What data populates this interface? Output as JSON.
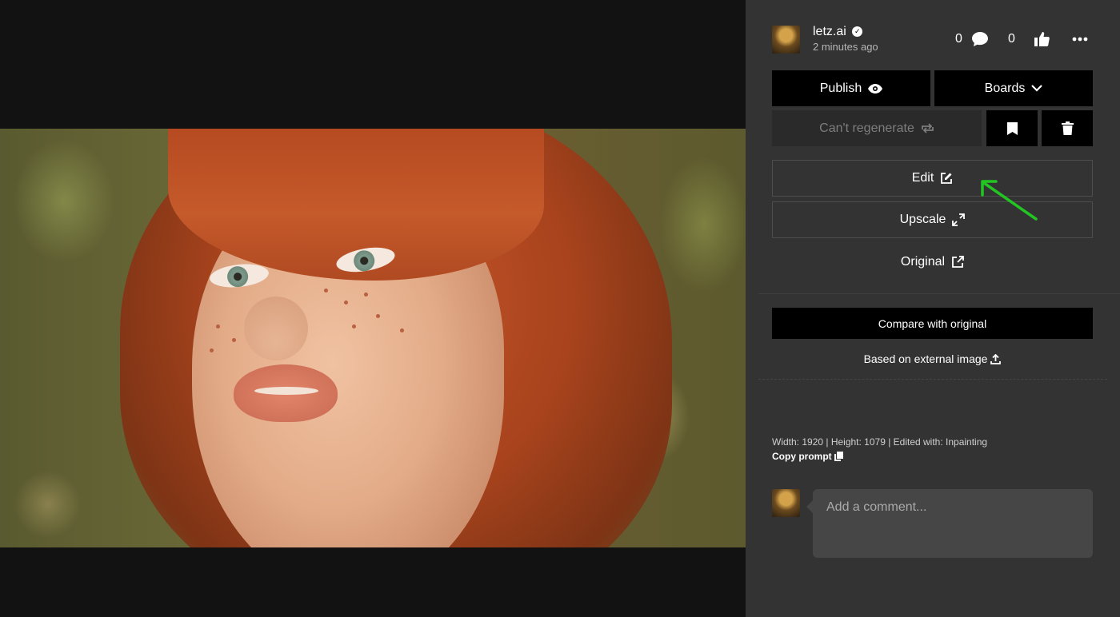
{
  "viewer": {
    "image_alt": "Portrait of a red-haired woman with freckles"
  },
  "header": {
    "username": "letz.ai",
    "timestamp": "2 minutes ago",
    "comment_count": "0",
    "like_count": "0"
  },
  "actions": {
    "publish_label": "Publish",
    "boards_label": "Boards",
    "regenerate_label": "Can't regenerate",
    "edit_label": "Edit",
    "upscale_label": "Upscale",
    "original_label": "Original",
    "compare_label": "Compare with original",
    "external_label": "Based on external image"
  },
  "meta": {
    "dimensions": "Width: 1920 | Height: 1079 | Edited with: Inpainting",
    "copy_prompt_label": "Copy prompt"
  },
  "comment": {
    "placeholder": "Add a comment..."
  },
  "icons": {
    "comment": "speech-bubble-icon",
    "like": "thumbs-up-icon",
    "more": "ellipsis-icon",
    "publish": "eye-icon",
    "boards": "chevron-down-icon",
    "regenerate": "repeat-icon",
    "bookmark": "bookmark-icon",
    "delete": "trash-icon",
    "edit": "edit-icon",
    "upscale": "expand-icon",
    "original": "external-link-icon",
    "upload": "upload-icon",
    "copy": "copy-icon"
  },
  "colors": {
    "panel": "#333333",
    "button_dark": "#000000",
    "annotation_arrow": "#22c522"
  }
}
